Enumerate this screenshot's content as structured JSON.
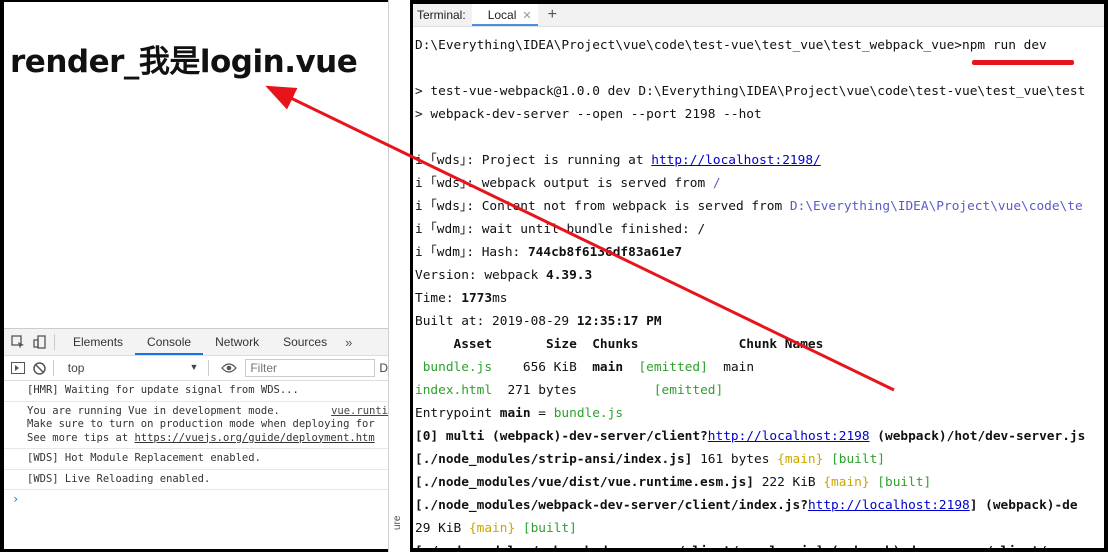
{
  "page": {
    "heading": "render_我是login.vue"
  },
  "devtools": {
    "tabs": [
      "Elements",
      "Console",
      "Network",
      "Sources"
    ],
    "more": "»",
    "context": "top",
    "filter_placeholder": "Filter",
    "filter_suffix": "D",
    "log": [
      {
        "text": "[HMR] Waiting for update signal from WDS..."
      },
      {
        "lines": [
          "You are running Vue in development mode.",
          "Make sure to turn on production mode when deploying for",
          "See more tips at "
        ],
        "link": "https://vuejs.org/guide/deployment.htm",
        "source": "vue.runti"
      },
      {
        "text": "[WDS] Hot Module Replacement enabled."
      },
      {
        "text": "[WDS] Live Reloading enabled."
      }
    ],
    "prompt": "›"
  },
  "divider": {
    "side_text": "ure"
  },
  "terminal": {
    "label": "Terminal:",
    "tab": "Local",
    "tab_close": "✕",
    "add": "+",
    "cmd_path": "D:\\Everything\\IDEA\\Project\\vue\\code\\test-vue\\test_vue\\test_webpack_vue>",
    "cmd": "npm run dev",
    "l1": "> test-vue-webpack@1.0.0 dev D:\\Everything\\IDEA\\Project\\vue\\code\\test-vue\\test_vue\\test",
    "l2": "> webpack-dev-server --open --port 2198 --hot",
    "wds1_pre": "i ｢wds｣: Project is running at ",
    "wds1_link": "http://localhost:2198/",
    "wds2_pre": "i ｢wds｣: webpack output is served from ",
    "wds2_path": "/",
    "wds3_pre": "i ｢wds｣: Content not from webpack is served from ",
    "wds3_path": "D:\\Everything\\IDEA\\Project\\vue\\code\\te",
    "wdm1": "i ｢wdm｣: wait until bundle finished: /",
    "wdm2_pre": "i ｢wdm｣: Hash: ",
    "hash": "744cb8f6136df83a61e7",
    "version_pre": "Version: webpack ",
    "version": "4.39.3",
    "time_pre": "Time: ",
    "time": "1773",
    "time_unit": "ms",
    "built_pre": "Built at: 2019-08-29 ",
    "built_time": "12:35:17 PM",
    "table_header": "     Asset       Size  Chunks             Chunk Names",
    "row1": {
      "asset": " bundle.js",
      "size": "    656 KiB",
      "chunk": "main",
      "status": "[emitted]",
      "name": "main"
    },
    "row2": {
      "asset": "index.html",
      "size": "  271 bytes",
      "status": "[emitted]"
    },
    "entry_pre": "Entrypoint ",
    "entry_main": "main",
    "entry_eq": " = ",
    "entry_file": "bundle.js",
    "m0_pre": "[0] multi (webpack)-dev-server/client?",
    "m0_link": "http://localhost:2198",
    "m0_post": " (webpack)/hot/dev-server.js",
    "m1_path": "[./node_modules/strip-ansi/index.js]",
    "m1_size": " 161 bytes ",
    "m2_path": "[./node_modules/vue/dist/vue.runtime.esm.js]",
    "m2_size": " 222 KiB ",
    "m3_pre": "[./node_modules/webpack-dev-server/client/index.js?",
    "m3_link": "http://localhost:2198",
    "m3_post": "] (webpack)-de",
    "m4_size": "29 KiB ",
    "m5": "[./node_modules/webpack-dev-server/client/overlay.js] (webpack)-dev-server/client/over",
    "chunk_main": "{main}",
    "built": "[built]"
  },
  "colors": {
    "annotation": "#e8141b",
    "link": "#0000cc",
    "emitted": "#2ea02e",
    "chunk": "#c8a800"
  }
}
